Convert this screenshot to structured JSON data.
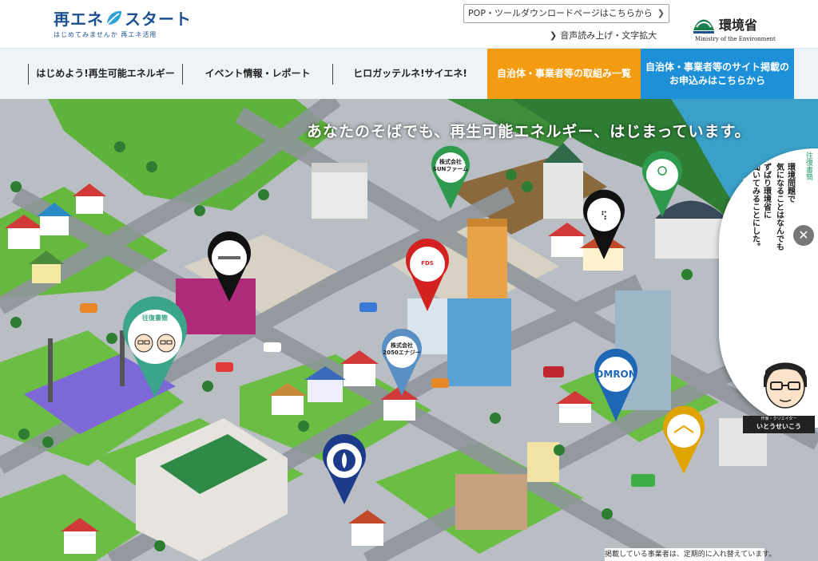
{
  "header": {
    "logo": {
      "main_left": "再エネ",
      "main_mark": "2",
      "main_right": "スタート",
      "tagline": "はじめてみませんか 再エネ活用"
    },
    "pop_button": {
      "label": "POP・ツールダウンロードページはこちらから",
      "icon": "chevron-right-icon"
    },
    "accessibility_link": {
      "label": "音声読み上げ・文字拡大",
      "icon": "chevron-right-icon"
    },
    "ministry": {
      "name": "環境省",
      "english": "Ministry of the Environment"
    }
  },
  "nav": {
    "items": [
      {
        "label": "はじめよう!再生可能エネルギー"
      },
      {
        "label": "イベント情報・レポート"
      },
      {
        "label": "ヒロガッテルネ!サイエネ!"
      },
      {
        "label": "自治体・事業者等の取組み一覧"
      },
      {
        "label_line1": "自治体・事業者等のサイト掲載の",
        "label_line2": "お申込みはこちらから"
      }
    ],
    "colors": {
      "bar_bg": "#eef3f7",
      "highlight_orange": "#f39c12",
      "highlight_blue": "#1e90d8"
    }
  },
  "map": {
    "headline": "あなたのそばでも、再生可能エネルギー、はじまっています。",
    "pins": [
      {
        "label_line1": "株式会社",
        "label_line2": "SUNファーム",
        "color": "#2e9a4e"
      },
      {
        "label_line1": "",
        "label_line2": "",
        "color": "#2e9a4e"
      },
      {
        "label_line1": "",
        "label_line2": "",
        "color": "#111111"
      },
      {
        "label_line1": "",
        "label_line2": "",
        "color": "#111111"
      },
      {
        "label_line1": "FDS",
        "label_line2": "",
        "color": "#d32020"
      },
      {
        "label_line1": "往復書簡",
        "label_line2": "",
        "color": "#3aa58a"
      },
      {
        "label_line1": "株式会社",
        "label_line2": "2050エナジー",
        "color": "#5a8fc4"
      },
      {
        "label_line1": "OMRON",
        "label_line2": "",
        "color": "#1e67b4"
      },
      {
        "label_line1": "",
        "label_line2": "",
        "color": "#e0a400"
      },
      {
        "label_line1": "",
        "label_line2": "",
        "color": "#1e3a8a"
      }
    ],
    "disclaimer": "掲載している事業者は、定期的に入れ替えています。"
  },
  "side_panel": {
    "tag": "往復書簡",
    "lines": [
      "環境問題で",
      "気になることはなんでも",
      "ずばり環境省に",
      "聞いてみることにした。"
    ],
    "creator_role": "作家・クリエイター",
    "creator_name": "いとうせいこう",
    "close_icon": "close-icon"
  }
}
